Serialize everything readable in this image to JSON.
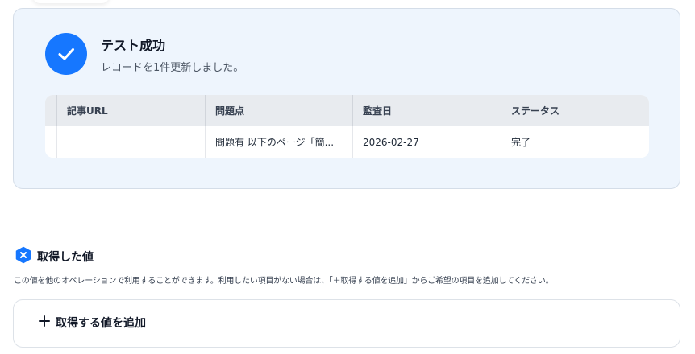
{
  "result": {
    "title": "テスト成功",
    "message": "レコードを1件更新しました。",
    "table": {
      "columns": [
        "記事URL",
        "問題点",
        "監査日",
        "ステータス"
      ],
      "rows": [
        [
          "",
          "問題有 以下のページ「簡...",
          "2026-02-27",
          "完了"
        ]
      ]
    }
  },
  "retrieved_values": {
    "title": "取得した値",
    "description": "この値を他のオペレーションで利用することができます。利用したい項目がない場合は、「＋取得する値を追加」からご希望の項目を追加してください。",
    "add_button_label": "取得する値を追加"
  },
  "colors": {
    "accent": "#1677ff",
    "card_background": "#eef5fd",
    "table_header": "#e8ebef"
  },
  "icons": {
    "success": "check-icon",
    "section": "hexagon-x-icon",
    "add": "plus-icon"
  }
}
